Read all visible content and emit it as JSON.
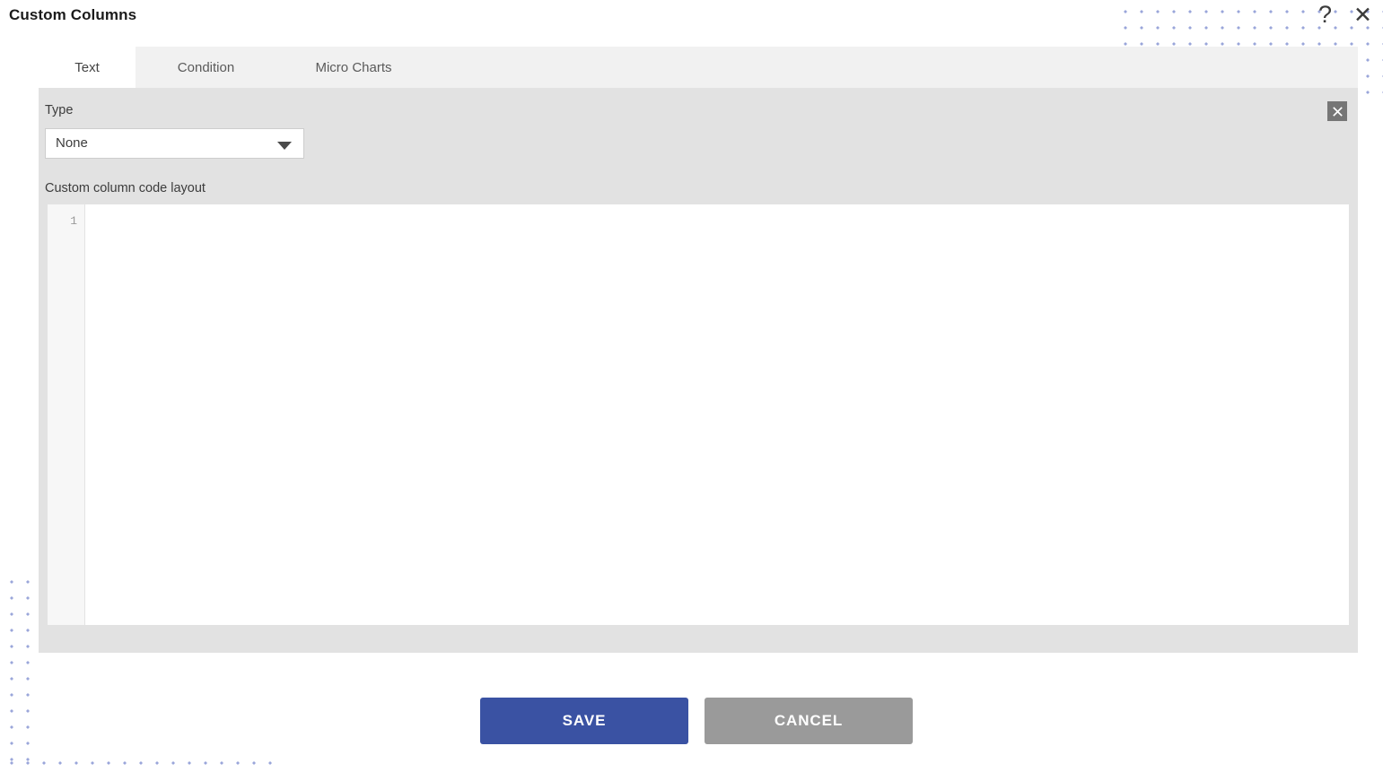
{
  "window": {
    "title": "Custom Columns",
    "help_icon_label": "?",
    "close_icon_label": "✕"
  },
  "tabs": [
    {
      "label": "Text",
      "active": true
    },
    {
      "label": "Condition",
      "active": false
    },
    {
      "label": "Micro Charts",
      "active": false
    }
  ],
  "form": {
    "type_label": "Type",
    "type_value": "None",
    "type_options": [
      "None"
    ],
    "code_layout_label": "Custom column code layout",
    "remove_button_label": "✕"
  },
  "editor": {
    "line_numbers": [
      "1"
    ],
    "content": "",
    "placeholder": ""
  },
  "footer": {
    "save_label": "SAVE",
    "cancel_label": "CANCEL"
  },
  "colors": {
    "save_blue": "#3a52a3",
    "cancel_gray": "#9a9a9a",
    "panel_gray": "#e2e2e2",
    "tabstrip_gray": "#f1f1f1",
    "active_tab": "#ffffff",
    "dot_pattern": "#9aa6da",
    "gutter_gray": "#f7f7f7",
    "remove_button_gray": "#767676"
  }
}
